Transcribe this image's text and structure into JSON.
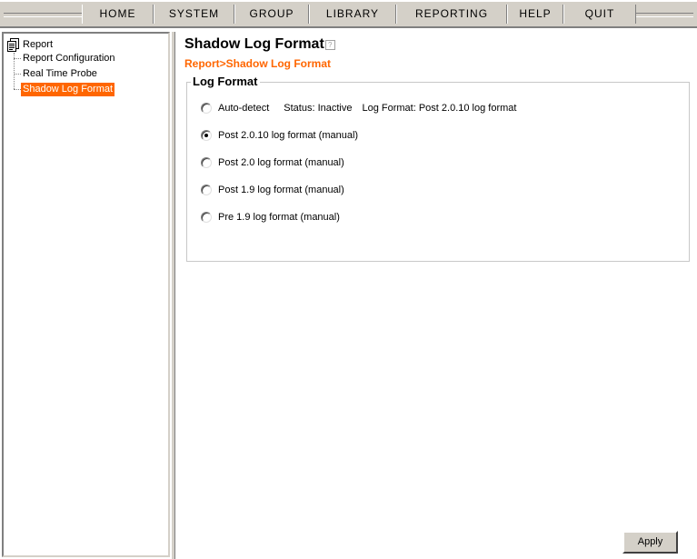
{
  "menu": {
    "items": [
      {
        "label": "HOME"
      },
      {
        "label": "SYSTEM"
      },
      {
        "label": "GROUP"
      },
      {
        "label": "LIBRARY"
      },
      {
        "label": "REPORTING"
      },
      {
        "label": "HELP"
      },
      {
        "label": "QUIT"
      }
    ]
  },
  "tree": {
    "root_label": "Report",
    "root_icon": "document-icon",
    "children": [
      {
        "label": "Report Configuration",
        "selected": false
      },
      {
        "label": "Real Time Probe",
        "selected": false
      },
      {
        "label": "Shadow Log Format",
        "selected": true
      }
    ]
  },
  "page": {
    "title": "Shadow Log Format",
    "help_icon": "help-icon",
    "breadcrumb": "Report>Shadow Log Format"
  },
  "log_format": {
    "legend": "Log Format",
    "options": [
      {
        "label": "Auto-detect",
        "checked": false
      },
      {
        "label": "Post 2.0.10 log format (manual)",
        "checked": true
      },
      {
        "label": "Post 2.0 log format (manual)",
        "checked": false
      },
      {
        "label": "Post 1.9 log format (manual)",
        "checked": false
      },
      {
        "label": "Pre 1.9 log format (manual)",
        "checked": false
      }
    ],
    "status_text": "Status: Inactive",
    "detected_format_text": "Log Format: Post 2.0.10 log format"
  },
  "actions": {
    "apply_label": "Apply"
  },
  "colors": {
    "accent": "#ff6600",
    "chrome": "#d4d0c8"
  }
}
